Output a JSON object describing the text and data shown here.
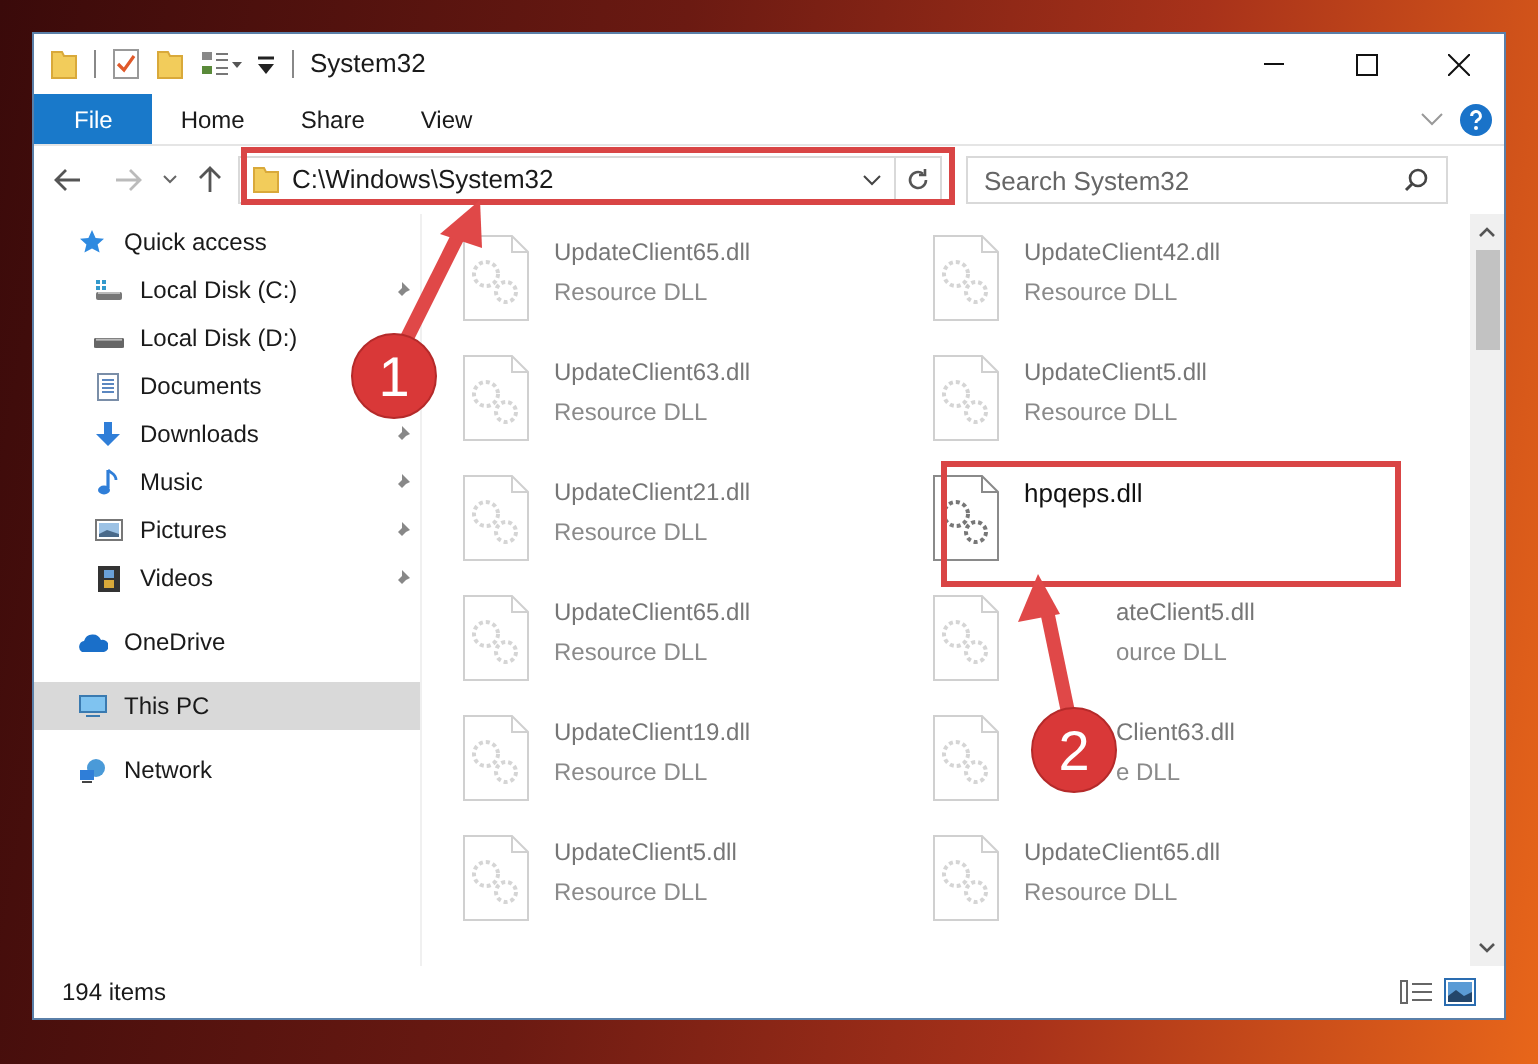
{
  "window": {
    "title": "System32"
  },
  "ribbon_tabs": [
    {
      "label": "File",
      "selected": true
    },
    {
      "label": "Home",
      "selected": false
    },
    {
      "label": "Share",
      "selected": false
    },
    {
      "label": "View",
      "selected": false
    }
  ],
  "address": {
    "path": "C:\\Windows\\System32"
  },
  "search": {
    "placeholder": "Search System32"
  },
  "sidebar": {
    "items": [
      {
        "label": "Quick access",
        "kind": "group",
        "selected": false,
        "pinned": false
      },
      {
        "label": "Local Disk (C:)",
        "kind": "child",
        "selected": false,
        "pinned": true
      },
      {
        "label": "Local Disk (D:)",
        "kind": "child",
        "selected": false,
        "pinned": false
      },
      {
        "label": "Documents",
        "kind": "child",
        "selected": false,
        "pinned": false
      },
      {
        "label": "Downloads",
        "kind": "child",
        "selected": false,
        "pinned": true
      },
      {
        "label": "Music",
        "kind": "child",
        "selected": false,
        "pinned": true
      },
      {
        "label": "Pictures",
        "kind": "child",
        "selected": false,
        "pinned": true
      },
      {
        "label": "Videos",
        "kind": "child",
        "selected": false,
        "pinned": true
      },
      {
        "label": "OneDrive",
        "kind": "group",
        "selected": false,
        "pinned": false
      },
      {
        "label": "This PC",
        "kind": "group",
        "selected": true,
        "pinned": false
      },
      {
        "label": "Network",
        "kind": "group",
        "selected": false,
        "pinned": false
      }
    ]
  },
  "files": [
    {
      "name": "UpdateClient65.dll",
      "type": "Resource DLL",
      "faded": true
    },
    {
      "name": "UpdateClient42.dll",
      "type": "Resource DLL",
      "faded": true
    },
    {
      "name": "UpdateClient63.dll",
      "type": "Resource DLL",
      "faded": true
    },
    {
      "name": "UpdateClient5.dll",
      "type": "Resource DLL",
      "faded": true
    },
    {
      "name": "UpdateClient21.dll",
      "type": "Resource DLL",
      "faded": true
    },
    {
      "name": "hpqeps.dll",
      "faded": false
    },
    {
      "name": "UpdateClient65.dll",
      "type": "Resource DLL",
      "faded": true
    },
    {
      "name": "ateClient5.dll",
      "type": "ource DLL",
      "faded": true,
      "covered": true
    },
    {
      "name": "UpdateClient19.dll",
      "type": "Resource DLL",
      "faded": true
    },
    {
      "name": "Client63.dll",
      "type": "e DLL",
      "faded": true,
      "covered": true
    },
    {
      "name": "UpdateClient5.dll",
      "type": "Resource DLL",
      "faded": true
    },
    {
      "name": "UpdateClient65.dll",
      "type": "Resource DLL",
      "faded": true
    }
  ],
  "status_bar": {
    "count": "194 items"
  },
  "annotations": [
    {
      "label": "1"
    },
    {
      "label": "2"
    }
  ]
}
